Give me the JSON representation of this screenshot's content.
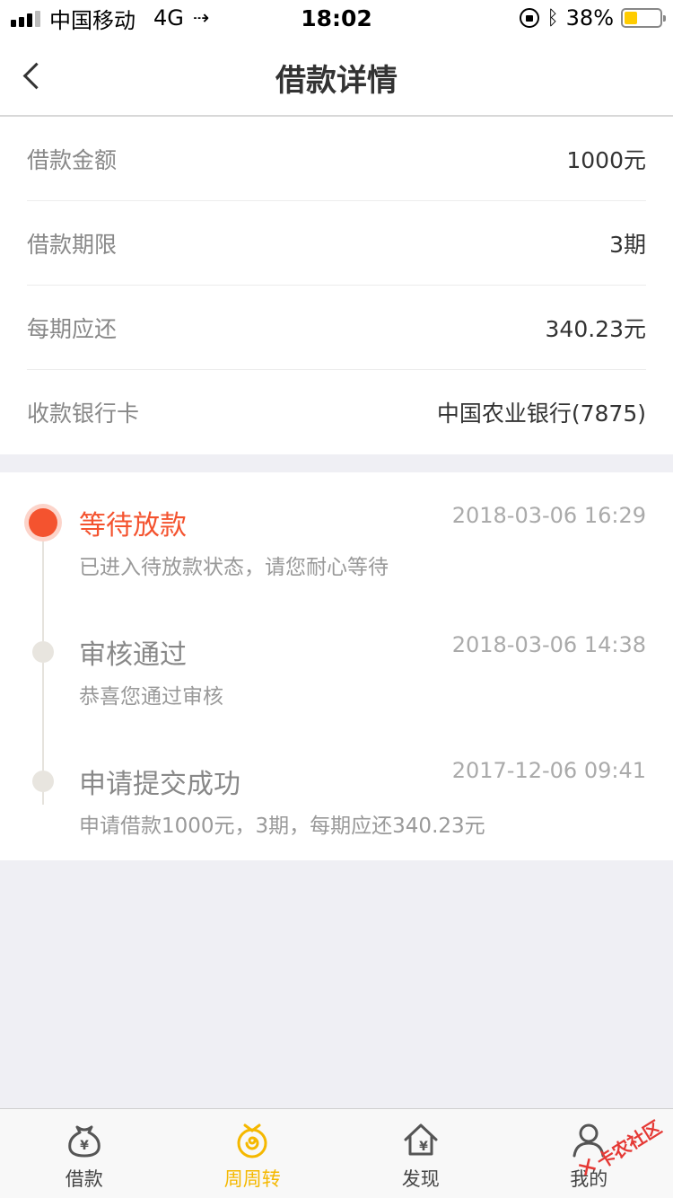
{
  "status_bar": {
    "carrier": "中国移动",
    "network": "4G",
    "time": "18:02",
    "battery": "38%",
    "battery_level": 0.38
  },
  "nav": {
    "title": "借款详情"
  },
  "info": [
    {
      "label": "借款金额",
      "value": "1000元"
    },
    {
      "label": "借款期限",
      "value": "3期"
    },
    {
      "label": "每期应还",
      "value": "340.23元"
    },
    {
      "label": "收款银行卡",
      "value": "中国农业银行(7875)"
    }
  ],
  "timeline": [
    {
      "title": "等待放款",
      "time": "2018-03-06 16:29",
      "desc": "已进入待放款状态，请您耐心等待",
      "active": true
    },
    {
      "title": "审核通过",
      "time": "2018-03-06 14:38",
      "desc": "恭喜您通过审核",
      "active": false
    },
    {
      "title": "申请提交成功",
      "time": "2017-12-06 09:41",
      "desc": "申请借款1000元，3期，每期应还340.23元",
      "active": false
    }
  ],
  "tabs": [
    {
      "label": "借款",
      "icon": "money-bag-icon",
      "active": false
    },
    {
      "label": "周周转",
      "icon": "coin-swirl-icon",
      "active": true
    },
    {
      "label": "发现",
      "icon": "house-yen-icon",
      "active": false
    },
    {
      "label": "我的",
      "icon": "person-icon",
      "active": false
    }
  ],
  "watermark": {
    "text": "卡农社区"
  },
  "colors": {
    "accent_red": "#f4532f",
    "tab_active": "#f5b800",
    "background": "#efeff4"
  }
}
